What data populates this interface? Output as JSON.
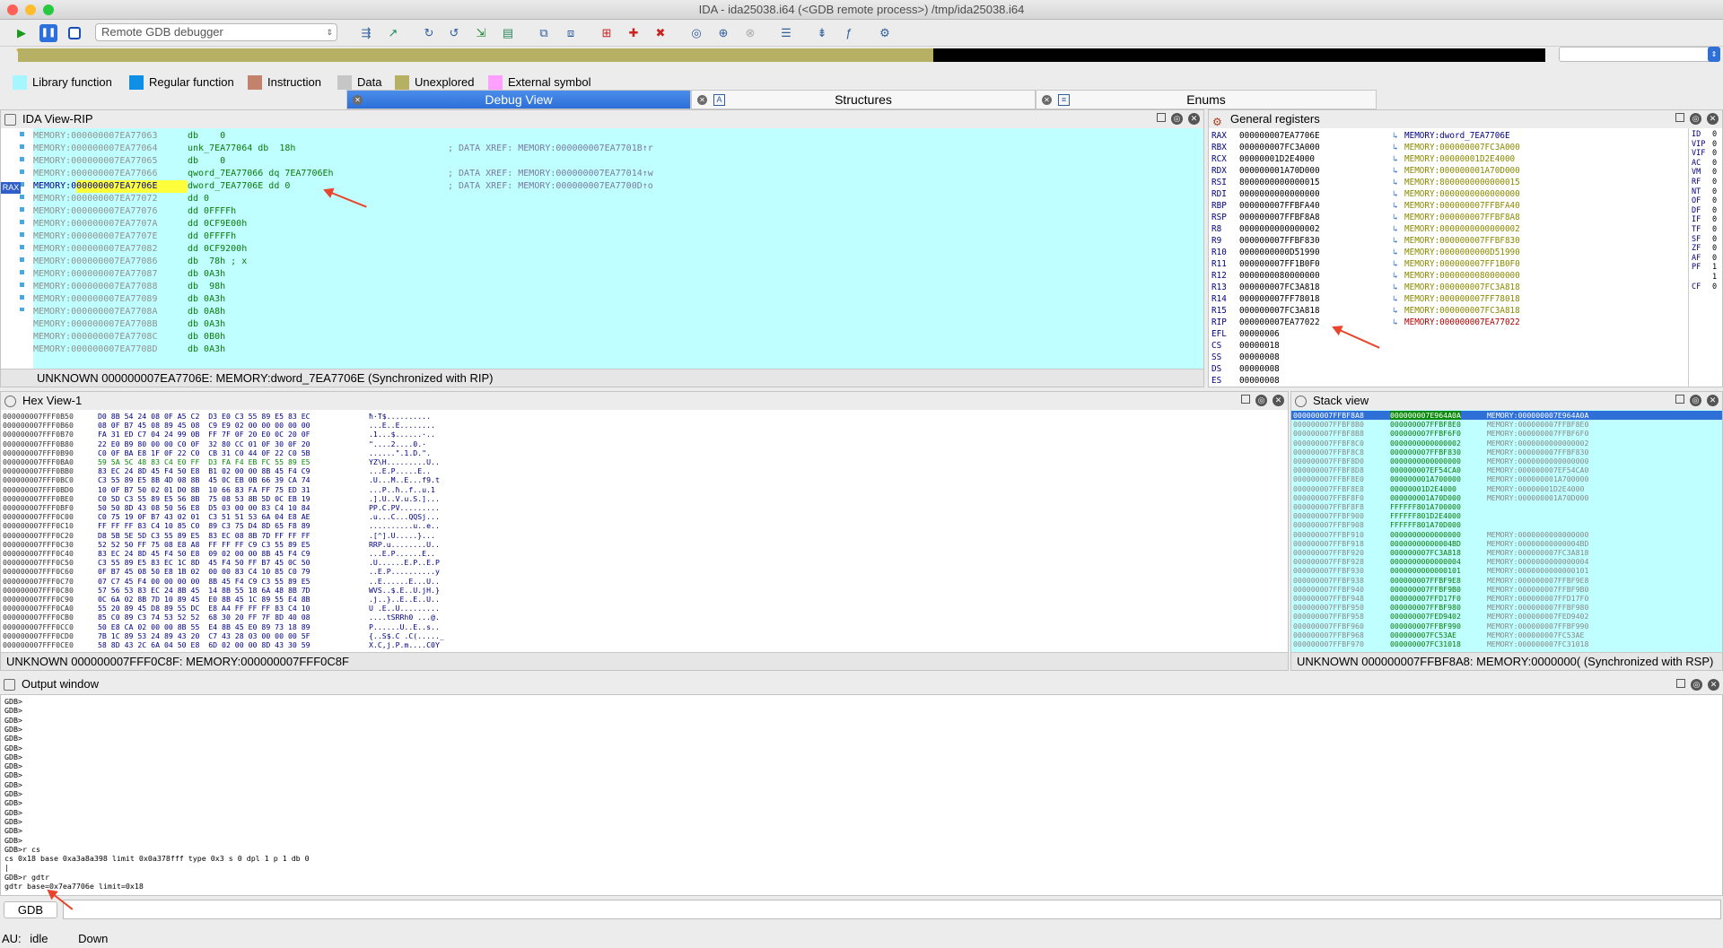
{
  "window": {
    "title": "IDA - ida25038.i64 (<GDB remote process>) /tmp/ida25038.i64"
  },
  "toolbar": {
    "debugger_select": "Remote GDB debugger"
  },
  "legend": [
    {
      "label": "Library function",
      "color": "#a6f6ff"
    },
    {
      "label": "Regular function",
      "color": "#0f8fe6"
    },
    {
      "label": "Instruction",
      "color": "#c2826b"
    },
    {
      "label": "Data",
      "color": "#c6c6c6"
    },
    {
      "label": "Unexplored",
      "color": "#b5b063"
    },
    {
      "label": "External symbol",
      "color": "#ff9fff"
    }
  ],
  "tabs": {
    "debug_view": "Debug View",
    "structures": "Structures",
    "enums": "Enums"
  },
  "ida_view": {
    "title": "IDA View-RIP",
    "rax_marker": "RAX",
    "lines": [
      {
        "addr": "MEMORY:000000007EA77063",
        "code": "db    0",
        "cmt": ""
      },
      {
        "addr": "MEMORY:000000007EA77064",
        "code": "unk_7EA77064 db  18h",
        "cmt": "; DATA XREF: MEMORY:000000007EA7701B↑r"
      },
      {
        "addr": "MEMORY:000000007EA77065",
        "code": "db    0",
        "cmt": ""
      },
      {
        "addr": "MEMORY:000000007EA77066",
        "code": "qword_7EA77066 dq 7EA7706Eh",
        "cmt": "; DATA XREF: MEMORY:000000007EA77014↑w"
      },
      {
        "addr": "MEMORY:000000007EA7706E",
        "code": "dword_7EA7706E dd 0",
        "cmt": "; DATA XREF: MEMORY:000000007EA7700D↑o"
      },
      {
        "addr": "MEMORY:000000007EA77072",
        "code": "dd 0",
        "cmt": ""
      },
      {
        "addr": "MEMORY:000000007EA77076",
        "code": "dd 0FFFFh",
        "cmt": ""
      },
      {
        "addr": "MEMORY:000000007EA7707A",
        "code": "dd 0CF9E00h",
        "cmt": ""
      },
      {
        "addr": "MEMORY:000000007EA7707E",
        "code": "dd 0FFFFh",
        "cmt": ""
      },
      {
        "addr": "MEMORY:000000007EA77082",
        "code": "dd 0CF9200h",
        "cmt": ""
      },
      {
        "addr": "MEMORY:000000007EA77086",
        "code": "db  78h ; x",
        "cmt": ""
      },
      {
        "addr": "MEMORY:000000007EA77087",
        "code": "db 0A3h",
        "cmt": ""
      },
      {
        "addr": "MEMORY:000000007EA77088",
        "code": "db  98h",
        "cmt": ""
      },
      {
        "addr": "MEMORY:000000007EA77089",
        "code": "db 0A3h",
        "cmt": ""
      },
      {
        "addr": "MEMORY:000000007EA7708A",
        "code": "db 0A8h",
        "cmt": ""
      },
      {
        "addr": "MEMORY:000000007EA7708B",
        "code": "db 0A3h",
        "cmt": ""
      },
      {
        "addr": "MEMORY:000000007EA7708C",
        "code": "db 0B0h",
        "cmt": ""
      },
      {
        "addr": "MEMORY:000000007EA7708D",
        "code": "db 0A3h",
        "cmt": ""
      }
    ],
    "status": "UNKNOWN  000000007EA7706E: MEMORY:dword_7EA7706E  (Synchronized with RIP)"
  },
  "registers": {
    "title": "General registers",
    "rows": [
      {
        "name": "RAX",
        "value": "000000007EA7706E",
        "ref": "MEMORY:dword_7EA7706E"
      },
      {
        "name": "RBX",
        "value": "000000007FC3A000",
        "ref": "MEMORY:000000007FC3A000"
      },
      {
        "name": "RCX",
        "value": "00000001D2E4000",
        "ref": "MEMORY:00000001D2E4000"
      },
      {
        "name": "RDX",
        "value": "000000001A70D000",
        "ref": "MEMORY:000000001A70D000"
      },
      {
        "name": "RSI",
        "value": "8000000000000015",
        "ref": "MEMORY:8000000000000015"
      },
      {
        "name": "RDI",
        "value": "0000000000000000",
        "ref": "MEMORY:0000000000000000"
      },
      {
        "name": "RBP",
        "value": "000000007FFBFA40",
        "ref": "MEMORY:000000007FFBFA40"
      },
      {
        "name": "RSP",
        "value": "000000007FFBF8A8",
        "ref": "MEMORY:000000007FFBF8A8"
      },
      {
        "name": "R8",
        "value": "0000000000000002",
        "ref": "MEMORY:0000000000000002"
      },
      {
        "name": "R9",
        "value": "000000007FFBF830",
        "ref": "MEMORY:000000007FFBF830"
      },
      {
        "name": "R10",
        "value": "0000000000D51990",
        "ref": "MEMORY:0000000000D51990"
      },
      {
        "name": "R11",
        "value": "000000007FF1B0F0",
        "ref": "MEMORY:000000007FF1B0F0"
      },
      {
        "name": "R12",
        "value": "0000000080000000",
        "ref": "MEMORY:0000000080000000"
      },
      {
        "name": "R13",
        "value": "000000007FC3A818",
        "ref": "MEMORY:000000007FC3A818"
      },
      {
        "name": "R14",
        "value": "000000007FF78018",
        "ref": "MEMORY:000000007FF78018"
      },
      {
        "name": "R15",
        "value": "000000007FC3A818",
        "ref": "MEMORY:000000007FC3A818"
      },
      {
        "name": "RIP",
        "value": "000000007EA77022",
        "ref": "MEMORY:000000007EA77022"
      },
      {
        "name": "EFL",
        "value": "00000006",
        "ref": ""
      },
      {
        "name": "CS",
        "value": "00000018",
        "ref": ""
      },
      {
        "name": "SS",
        "value": "00000008",
        "ref": ""
      },
      {
        "name": "DS",
        "value": "00000008",
        "ref": ""
      },
      {
        "name": "ES",
        "value": "00000008",
        "ref": ""
      },
      {
        "name": "FS",
        "value": "00000008",
        "ref": ""
      }
    ],
    "flags": [
      {
        "name": "ID",
        "value": "0"
      },
      {
        "name": "VIP",
        "value": "0"
      },
      {
        "name": "VIF",
        "value": "0"
      },
      {
        "name": "AC",
        "value": "0"
      },
      {
        "name": "VM",
        "value": "0"
      },
      {
        "name": "RF",
        "value": "0"
      },
      {
        "name": "NT",
        "value": "0"
      },
      {
        "name": "OF",
        "value": "0"
      },
      {
        "name": "DF",
        "value": "0"
      },
      {
        "name": "IF",
        "value": "0"
      },
      {
        "name": "TF",
        "value": "0"
      },
      {
        "name": "SF",
        "value": "0"
      },
      {
        "name": "ZF",
        "value": "0"
      },
      {
        "name": "AF",
        "value": "0"
      },
      {
        "name": "PF",
        "value": "1"
      },
      {
        "name": "",
        "value": "1"
      },
      {
        "name": "CF",
        "value": "0"
      }
    ]
  },
  "hex_view": {
    "title": "Hex View-1",
    "rows": [
      {
        "addr": "000000007FFF0B50",
        "bytes": "D0 8B 54 24 08 0F A5 C2  D3 E0 C3 55 89 E5 83 EC",
        "ascii": "ħ·T$.........."
      },
      {
        "addr": "000000007FFF0B60",
        "bytes": "08 0F B7 45 08 89 45 08  C9 E9 02 00 00 00 00 00",
        "ascii": "...E..E........"
      },
      {
        "addr": "000000007FFF0B70",
        "bytes": "FA 31 ED C7 04 24 99 0B  FF 7F 0F 20 E0 0C 20 0F",
        "ascii": ".1...$......·.."
      },
      {
        "addr": "000000007FFF0B80",
        "bytes": "22 E0 B9 80 00 00 C0 0F  32 80 CC 01 0F 30 0F 20",
        "ascii": "\"....2....0.·"
      },
      {
        "addr": "000000007FFF0B90",
        "bytes": "C0 0F BA E8 1F 0F 22 C0  CB 31 C0 44 0F 22 C0 5B",
        "ascii": "......\".1.D.\"."
      },
      {
        "addr": "000000007FFF0BA0",
        "bytes": "59 5A 5C 48 83 C4 E0 FF  D3 FA F4 EB FC 55 89 E5",
        "ascii": "YZ\\H.........U.."
      },
      {
        "addr": "000000007FFF0BB0",
        "bytes": "83 EC 24 8D 45 F4 50 E8  B1 02 00 00 8B 45 F4 C9",
        "ascii": "...E.P.....E.."
      },
      {
        "addr": "000000007FFF0BC0",
        "bytes": "C3 55 89 E5 8B 4D 08 8B  45 0C EB 0B 66 39 CA 74",
        "ascii": ".U...M..E...f9.t"
      },
      {
        "addr": "000000007FFF0BD0",
        "bytes": "10 0F B7 50 02 01 D0 8B  10 66 83 FA FF 75 ED 31",
        "ascii": "...P..ħ..f..u.1"
      },
      {
        "addr": "000000007FFF0BE0",
        "bytes": "C0 5D C3 55 89 E5 56 8B  75 08 53 8B 5D 0C EB 19",
        "ascii": ".].U..V.u.S.]..."
      },
      {
        "addr": "000000007FFF0BF0",
        "bytes": "50 50 8D 43 08 50 56 E8  D5 03 00 00 83 C4 10 84",
        "ascii": "PP.C.PV........."
      },
      {
        "addr": "000000007FFF0C00",
        "bytes": "C0 75 19 0F B7 43 02 01  C3 51 51 53 6A 04 E8 AE",
        "ascii": ".u...C...QQSj..."
      },
      {
        "addr": "000000007FFF0C10",
        "bytes": "FF FF FF 83 C4 10 85 C0  89 C3 75 D4 8D 65 F8 89",
        "ascii": "..........u..e.."
      },
      {
        "addr": "000000007FFF0C20",
        "bytes": "D8 5B 5E 5D C3 55 89 E5  83 EC 08 8B 7D FF FF FF",
        "ascii": ".[^].U.....}..."
      },
      {
        "addr": "000000007FFF0C30",
        "bytes": "52 52 50 FF 75 08 E8 A8  FF FF FF C9 C3 55 89 E5",
        "ascii": "RRP.u........U.."
      },
      {
        "addr": "000000007FFF0C40",
        "bytes": "83 EC 24 8D 45 F4 50 E8  09 02 00 00 8B 45 F4 C9",
        "ascii": "...E.P......E.."
      },
      {
        "addr": "000000007FFF0C50",
        "bytes": "C3 55 89 E5 83 EC 1C 8D  45 F4 50 FF B7 45 0C 50",
        "ascii": ".U......E.P..E.P"
      },
      {
        "addr": "000000007FFF0C60",
        "bytes": "0F B7 45 08 50 E8 1B 02  00 00 83 C4 10 85 C0 79",
        "ascii": "..E.P..........y"
      },
      {
        "addr": "000000007FFF0C70",
        "bytes": "07 C7 45 F4 00 00 00 00  8B 45 F4 C9 C3 55 89 E5",
        "ascii": "..E......E...U.."
      },
      {
        "addr": "000000007FFF0C80",
        "bytes": "57 56 53 83 EC 24 8B 45  14 8B 55 18 6A 48 8B 7D",
        "ascii": "WVS..$.E..U.jH.}"
      },
      {
        "addr": "000000007FFF0C90",
        "bytes": "0C 6A 02 8B 7D 10 89 45  E0 8B 45 1C 89 55 E4 8B",
        "ascii": ".j..}..E..E..U.."
      },
      {
        "addr": "000000007FFF0CA0",
        "bytes": "55 20 89 45 D8 89 55 DC  E8 A4 FF FF FF 83 C4 10",
        "ascii": "U .E..U........."
      },
      {
        "addr": "000000007FFF0CB0",
        "bytes": "85 C0 89 C3 74 53 52 52  68 30 20 FF 7F 8D 40 08",
        "ascii": "....tSRRh0 ...@."
      },
      {
        "addr": "000000007FFF0CC0",
        "bytes": "50 E8 CA 02 00 00 8B 55  E4 8B 45 E0 89 73 18 89",
        "ascii": "P......U..E..s.."
      },
      {
        "addr": "000000007FFF0CD0",
        "bytes": "7B 1C 89 53 24 89 43 20  C7 43 28 03 00 00 00 5F",
        "ascii": "{..S$.C .C(....._"
      },
      {
        "addr": "000000007FFF0CE0",
        "bytes": "58 8D 43 2C 6A 04 50 E8  6D 02 00 00 8D 43 30 59",
        "ascii": "X.C,j.P.m....C0Y"
      }
    ],
    "status": "UNKNOWN  000000007FFF0C8F: MEMORY:000000007FFF0C8F"
  },
  "stack_view": {
    "title": "Stack view",
    "rows": [
      {
        "addr": "000000007FFBF8A8",
        "value": "000000007E964A0A",
        "ref": "MEMORY:000000007E964A0A"
      },
      {
        "addr": "000000007FFBF8B0",
        "value": "000000007FFBF8E0",
        "ref": "MEMORY:000000007FFBF8E0"
      },
      {
        "addr": "000000007FFBF8B8",
        "value": "000000007FFBF6F0",
        "ref": "MEMORY:000000007FFBF6F0"
      },
      {
        "addr": "000000007FFBF8C0",
        "value": "0000000000000002",
        "ref": "MEMORY:0000000000000002"
      },
      {
        "addr": "000000007FFBF8C8",
        "value": "000000007FFBF830",
        "ref": "MEMORY:000000007FFBF830"
      },
      {
        "addr": "000000007FFBF8D0",
        "value": "0000000000000000",
        "ref": "MEMORY:0000000000000000"
      },
      {
        "addr": "000000007FFBF8D8",
        "value": "000000007EF54CA0",
        "ref": "MEMORY:000000007EF54CA0"
      },
      {
        "addr": "000000007FFBF8E0",
        "value": "000000001A700000",
        "ref": "MEMORY:000000001A700000"
      },
      {
        "addr": "000000007FFBF8E8",
        "value": "00000001D2E4000",
        "ref": "MEMORY:00000001D2E4000"
      },
      {
        "addr": "000000007FFBF8F0",
        "value": "000000001A70D000",
        "ref": "MEMORY:000000001A70D000"
      },
      {
        "addr": "000000007FFBF8F8",
        "value": "FFFFFF801A700000",
        "ref": ""
      },
      {
        "addr": "000000007FFBF900",
        "value": "FFFFFF801D2E4000",
        "ref": ""
      },
      {
        "addr": "000000007FFBF908",
        "value": "FFFFFF801A70D000",
        "ref": ""
      },
      {
        "addr": "000000007FFBF910",
        "value": "0000000000000000",
        "ref": "MEMORY:0000000000000000"
      },
      {
        "addr": "000000007FFBF918",
        "value": "00000000000004BD",
        "ref": "MEMORY:00000000000004BD"
      },
      {
        "addr": "000000007FFBF920",
        "value": "000000007FC3A818",
        "ref": "MEMORY:000000007FC3A818"
      },
      {
        "addr": "000000007FFBF928",
        "value": "0000000000000004",
        "ref": "MEMORY:0000000000000004"
      },
      {
        "addr": "000000007FFBF930",
        "value": "0000000000000101",
        "ref": "MEMORY:0000000000000101"
      },
      {
        "addr": "000000007FFBF938",
        "value": "000000007FFBF9E8",
        "ref": "MEMORY:000000007FFBF9E8"
      },
      {
        "addr": "000000007FFBF940",
        "value": "000000007FFBF9B0",
        "ref": "MEMORY:000000007FFBF9B0"
      },
      {
        "addr": "000000007FFBF948",
        "value": "000000007FFD17F0",
        "ref": "MEMORY:000000007FFD17F0"
      },
      {
        "addr": "000000007FFBF950",
        "value": "000000007FFBF980",
        "ref": "MEMORY:000000007FFBF980"
      },
      {
        "addr": "000000007FFBF958",
        "value": "000000007FED9402",
        "ref": "MEMORY:000000007FED9402"
      },
      {
        "addr": "000000007FFBF960",
        "value": "000000007FFBF990",
        "ref": "MEMORY:000000007FFBF990"
      },
      {
        "addr": "000000007FFBF968",
        "value": "000000007FC53AE",
        "ref": "MEMORY:000000007FC53AE"
      },
      {
        "addr": "000000007FFBF970",
        "value": "000000007FC31018",
        "ref": "MEMORY:000000007FC31018"
      }
    ],
    "status": "UNKNOWN  000000007FFBF8A8: MEMORY:0000000( (Synchronized with RSP)"
  },
  "output": {
    "title": "Output window",
    "lines": [
      "GDB>",
      "GDB>",
      "GDB>",
      "GDB>",
      "GDB>",
      "GDB>",
      "GDB>",
      "GDB>",
      "GDB>",
      "GDB>",
      "GDB>",
      "GDB>",
      "GDB>",
      "GDB>",
      "GDB>",
      "GDB>",
      "GDB>r cs",
      "cs 0x18 base 0xa3a8a398 limit 0x0a378fff type 0x3 s 0 dpl 1 p 1 db 0",
      "|",
      "GDB>r gdtr",
      "gdtr base=0x7ea7706e limit=0x18"
    ],
    "gdb_tab": "GDB"
  },
  "statusbar": {
    "au_label": "AU:",
    "au_state": "idle",
    "direction": "Down"
  }
}
